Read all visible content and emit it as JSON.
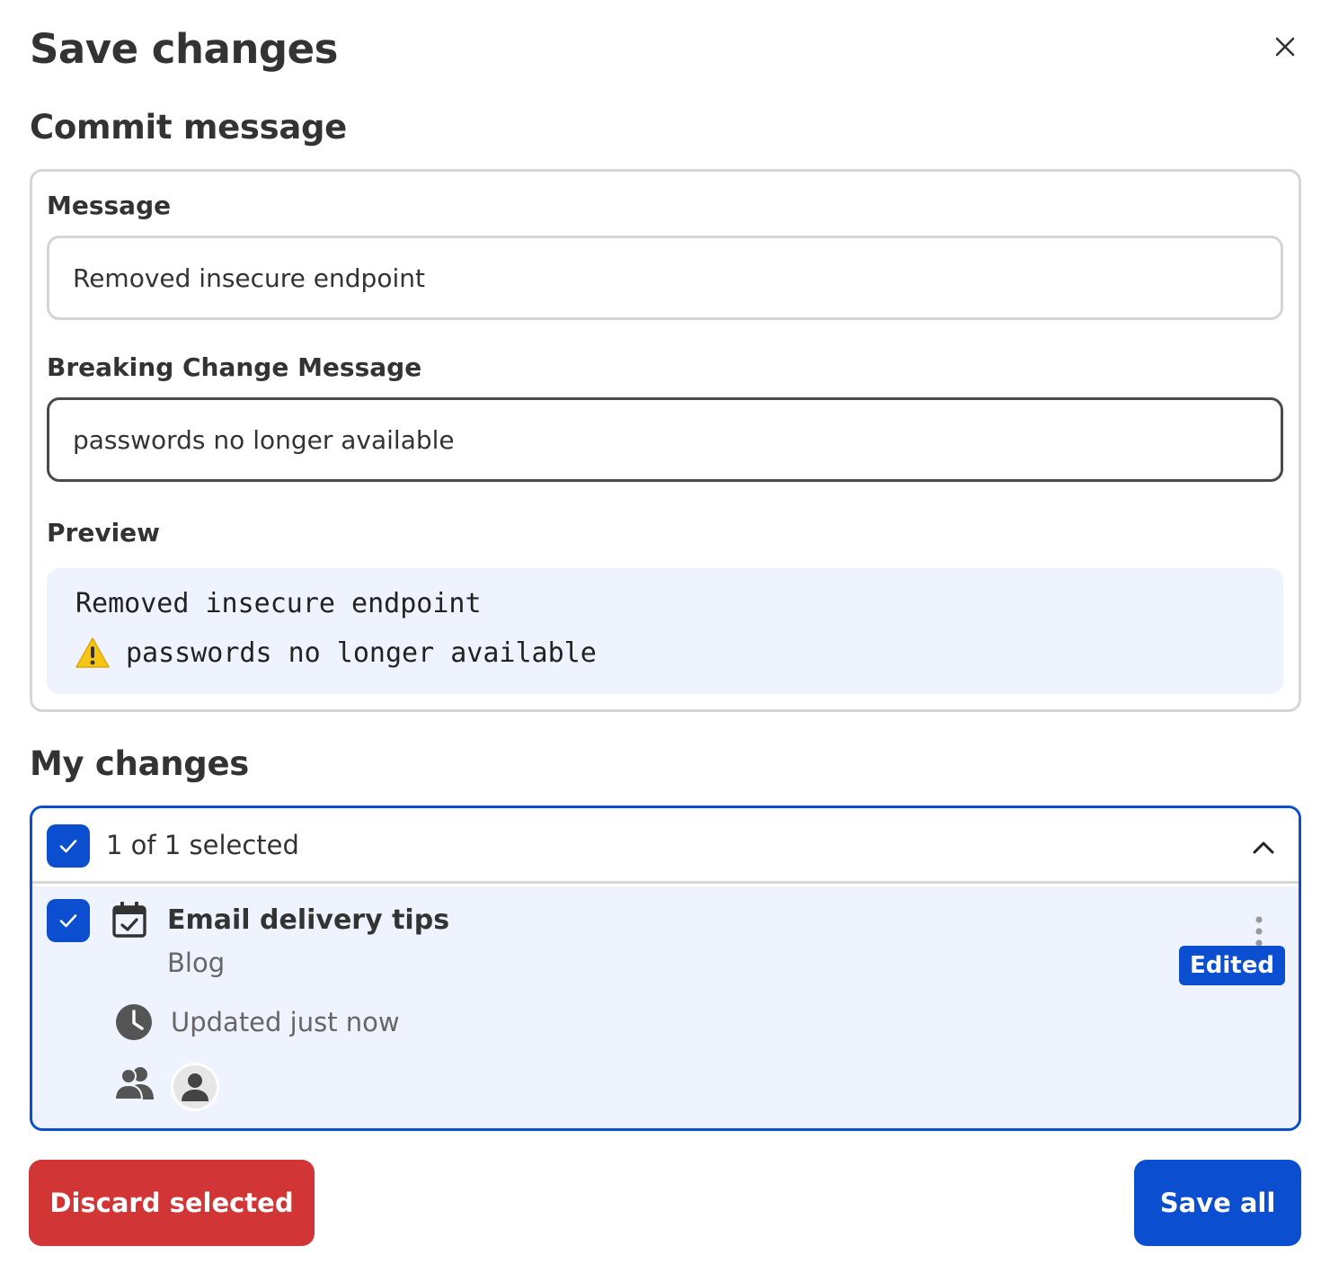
{
  "dialog": {
    "title": "Save changes"
  },
  "commit": {
    "heading": "Commit message",
    "message_label": "Message",
    "message_value": "Removed insecure endpoint",
    "breaking_label": "Breaking Change Message",
    "breaking_value": "passwords no longer available",
    "preview_label": "Preview",
    "preview_line_1": "Removed insecure endpoint",
    "preview_line_2": "passwords no longer available"
  },
  "changes": {
    "heading": "My changes",
    "selected_count": "1 of 1 selected",
    "items": [
      {
        "title": "Email delivery tips",
        "subtitle": "Blog",
        "badge": "Edited",
        "updated": "Updated just now"
      }
    ]
  },
  "actions": {
    "discard_label": "Discard selected",
    "save_label": "Save all"
  },
  "colors": {
    "primary": "#0b4fd0",
    "danger": "#d13535",
    "preview_bg": "#eef3fd"
  }
}
